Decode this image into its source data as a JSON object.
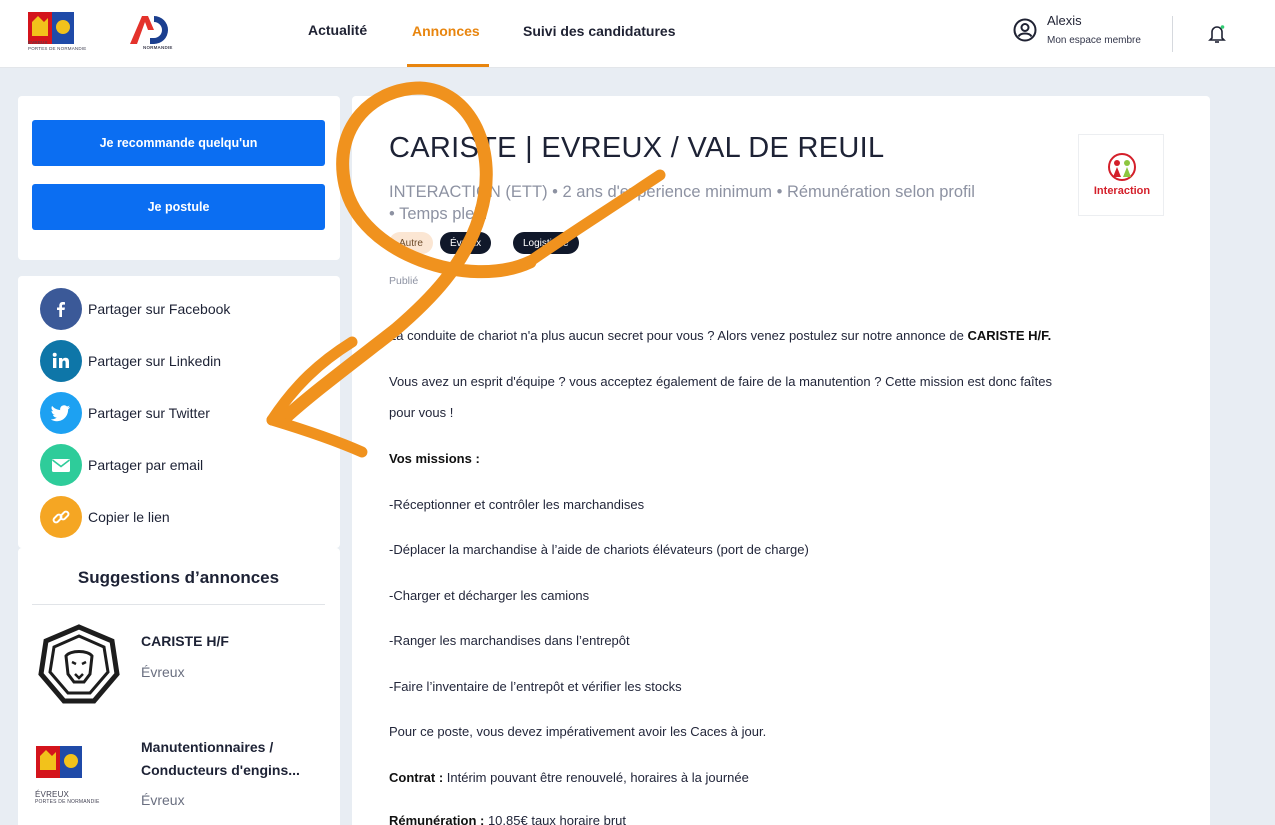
{
  "header": {
    "logo_left": {
      "name": "ÉVREUX",
      "sub": "PORTES DE NORMANDIE"
    },
    "logo_right": {
      "mark": "AD",
      "name": "NORMANDIE"
    },
    "nav": [
      {
        "label": "Actualité",
        "active": false
      },
      {
        "label": "Annonces",
        "active": true
      },
      {
        "label": "Suivi des candidatures",
        "active": false
      }
    ],
    "user": {
      "name": "Alexis",
      "subtitle": "Mon espace membre"
    }
  },
  "actions": {
    "recommend_label": "Je recommande quelqu'un",
    "apply_label": "Je postule"
  },
  "share": [
    {
      "label": "Partager sur Facebook",
      "icon": "facebook-icon",
      "color": "#3b5998"
    },
    {
      "label": "Partager sur Linkedin",
      "icon": "linkedin-icon",
      "color": "#0e76a8"
    },
    {
      "label": "Partager sur Twitter",
      "icon": "twitter-icon",
      "color": "#1da1f2"
    },
    {
      "label": "Partager par email",
      "icon": "email-icon",
      "color": "#2ecc9a"
    },
    {
      "label": "Copier le lien",
      "icon": "link-icon",
      "color": "#f5a623"
    }
  ],
  "suggestions": {
    "title": "Suggestions d’annonces",
    "items": [
      {
        "title": "CARISTE H/F",
        "city": "Évreux",
        "logo": "lion-icon"
      },
      {
        "title_line1": "Manutentionnaires /",
        "title_line2": "Conducteurs d'engins...",
        "city": "Évreux",
        "logo": "evreux-logo",
        "logo_text": "ÉVREUX",
        "logo_sub": "PORTES DE NORMANDIE"
      }
    ]
  },
  "job": {
    "title": "CARISTE | EVREUX / VAL DE REUIL",
    "meta_line1": "INTERACTION (ETT) • 2 ans d'expérience minimum • Rémunération selon profil",
    "meta_line2": "• Temps plein",
    "company_logo_text": "Interaction",
    "tags": [
      "Autre",
      "Évreux",
      "Logistique"
    ],
    "published": "Publié",
    "intro_text": "La conduite de chariot n'a plus aucun secret pour vous ? Alors venez postulez sur notre annonce de ",
    "intro_bold": "CARISTE H/F.",
    "para2_line1": "Vous avez un esprit d'équipe ? vous acceptez également de faire de la manutention ? Cette mission est donc faîtes",
    "para2_line2": "pour vous !",
    "missions_title": "Vos missions :",
    "missions": [
      "-Réceptionner et contrôler les marchandises",
      "-Déplacer la marchandise à l’aide de chariots élévateurs (port de charge)",
      "-Charger et décharger les camions",
      "-Ranger les marchandises dans l’entrepôt",
      "-Faire l’inventaire de l’entrepôt et vérifier les stocks"
    ],
    "requirement": "Pour ce poste, vous devez impérativement avoir les Caces à jour.",
    "contract_label": "Contrat :",
    "contract_value": " Intérim pouvant être renouvelé, horaires à la journée",
    "salary_label": "Rémunération :",
    "salary_value": " 10,85€ taux horaire brut"
  },
  "colors": {
    "accent": "#e8850e",
    "primary_button": "#0b6ef2",
    "annotation": "#f0921e"
  }
}
